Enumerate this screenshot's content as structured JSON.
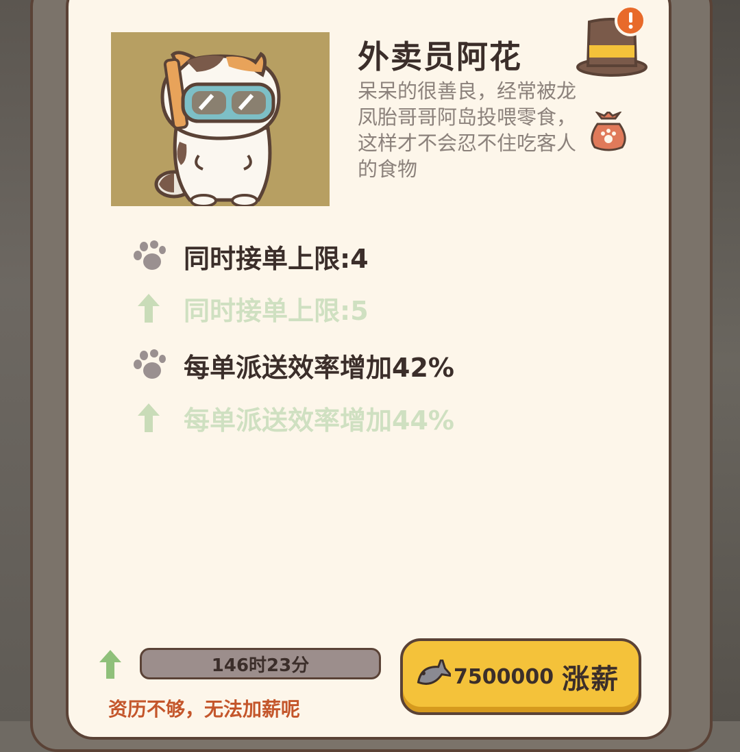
{
  "character": {
    "name": "外卖员阿花",
    "description": "呆呆的很善良，经常被龙凤胎哥哥阿岛投喂零食，这样才不会忍不住吃客人的食物"
  },
  "stats": [
    {
      "icon": "paw-icon",
      "text": "同时接单上限:4",
      "type": "current"
    },
    {
      "icon": "arrow-up-icon",
      "text": "同时接单上限:5",
      "type": "next"
    },
    {
      "icon": "paw-icon",
      "text": "每单派送效率增加42%",
      "type": "current"
    },
    {
      "icon": "arrow-up-icon",
      "text": "每单派送效率增加44%",
      "type": "next"
    }
  ],
  "upgrade": {
    "time_remaining": "146时23分",
    "warning": "资历不够，无法加薪呢",
    "cost": "7500000",
    "button_label": "涨薪"
  },
  "colors": {
    "card_bg": "#fdf6ea",
    "border": "#5a4236",
    "button": "#f4c23a",
    "warning": "#c4562b",
    "next_stat": "#cfe0c1"
  }
}
